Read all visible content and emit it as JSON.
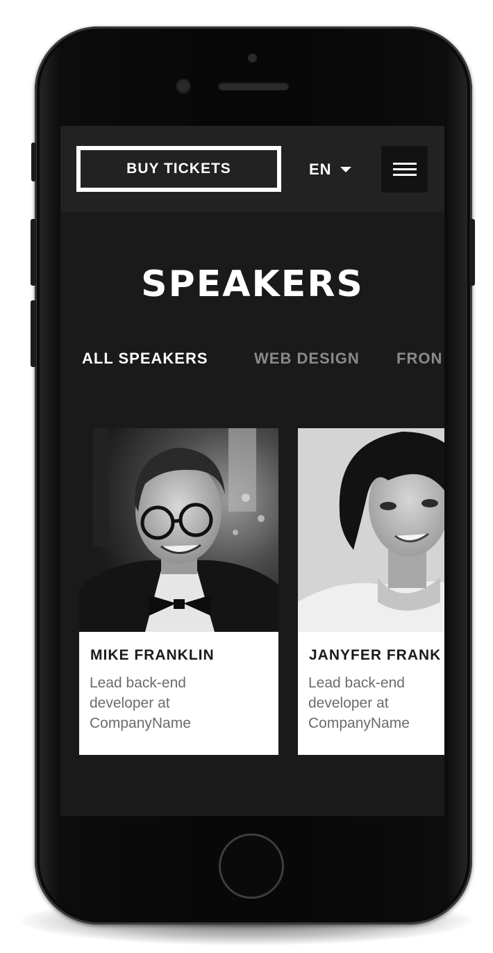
{
  "header": {
    "buy_tickets_label": "BUY TICKETS",
    "language": "EN"
  },
  "page_title": "SPEAKERS",
  "tabs": [
    {
      "label": "ALL SPEAKERS",
      "active": true
    },
    {
      "label": "WEB DESIGN",
      "active": false
    },
    {
      "label": "FRON",
      "active": false
    }
  ],
  "speakers": [
    {
      "name": "MIKE FRANKLIN",
      "role": "Lead back-end developer at CompanyName"
    },
    {
      "name": "JANYFER FRANK",
      "role": "Lead back-end developer at CompanyName"
    }
  ],
  "colors": {
    "screen_bg": "#1a1a1a",
    "topbar_bg": "#222222",
    "accent": "#ffffff",
    "inactive_tab": "#8a8a8a"
  },
  "icons": {
    "menu": "hamburger-menu-icon",
    "language_dropdown": "caret-down-icon"
  }
}
